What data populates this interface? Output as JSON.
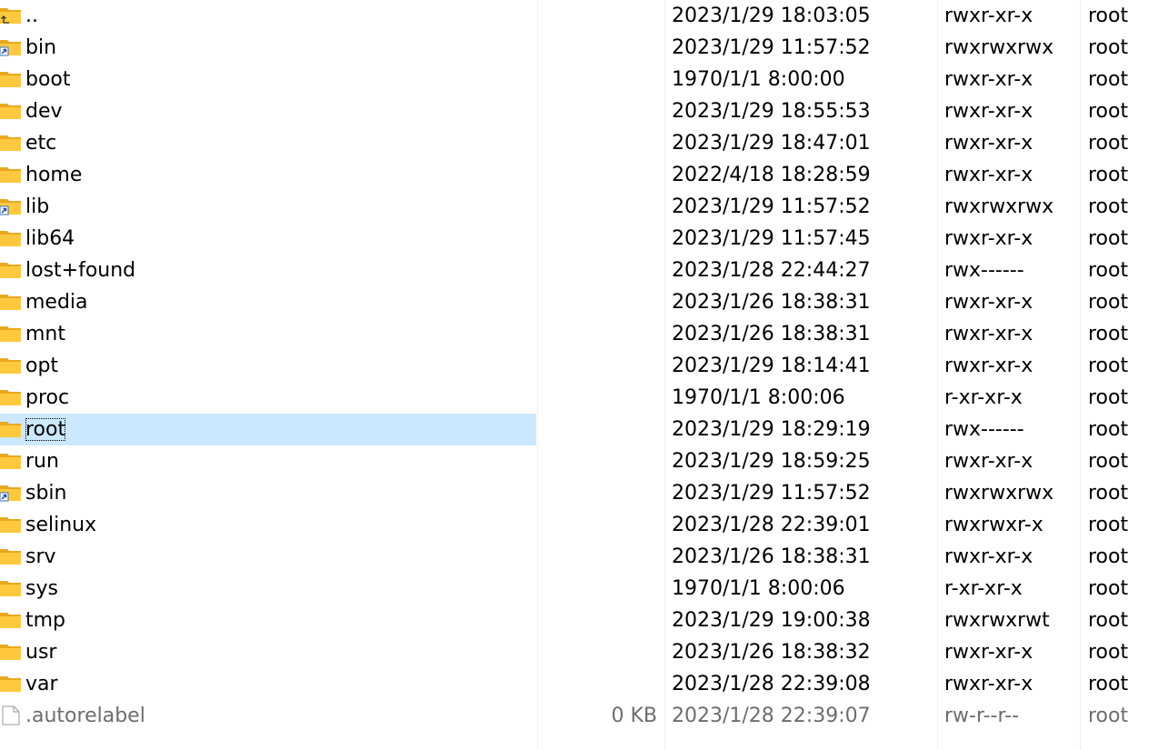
{
  "colors": {
    "selection": "#cce8ff",
    "folder": "#ffc93f",
    "file_text": "#6d6d6d"
  },
  "rows": [
    {
      "name": "..",
      "size": "",
      "date": "2023/1/29 18:03:05",
      "perm": "rwxr-xr-x",
      "owner": "root",
      "icon": "parent-folder-icon"
    },
    {
      "name": "bin",
      "size": "",
      "date": "2023/1/29 11:57:52",
      "perm": "rwxrwxrwx",
      "owner": "root",
      "icon": "folder-shortcut-icon"
    },
    {
      "name": "boot",
      "size": "",
      "date": "1970/1/1 8:00:00",
      "perm": "rwxr-xr-x",
      "owner": "root",
      "icon": "folder-icon"
    },
    {
      "name": "dev",
      "size": "",
      "date": "2023/1/29 18:55:53",
      "perm": "rwxr-xr-x",
      "owner": "root",
      "icon": "folder-icon"
    },
    {
      "name": "etc",
      "size": "",
      "date": "2023/1/29 18:47:01",
      "perm": "rwxr-xr-x",
      "owner": "root",
      "icon": "folder-icon"
    },
    {
      "name": "home",
      "size": "",
      "date": "2022/4/18 18:28:59",
      "perm": "rwxr-xr-x",
      "owner": "root",
      "icon": "folder-icon"
    },
    {
      "name": "lib",
      "size": "",
      "date": "2023/1/29 11:57:52",
      "perm": "rwxrwxrwx",
      "owner": "root",
      "icon": "folder-shortcut-icon"
    },
    {
      "name": "lib64",
      "size": "",
      "date": "2023/1/29 11:57:45",
      "perm": "rwxr-xr-x",
      "owner": "root",
      "icon": "folder-icon"
    },
    {
      "name": "lost+found",
      "size": "",
      "date": "2023/1/28 22:44:27",
      "perm": "rwx------",
      "owner": "root",
      "icon": "folder-icon"
    },
    {
      "name": "media",
      "size": "",
      "date": "2023/1/26 18:38:31",
      "perm": "rwxr-xr-x",
      "owner": "root",
      "icon": "folder-icon"
    },
    {
      "name": "mnt",
      "size": "",
      "date": "2023/1/26 18:38:31",
      "perm": "rwxr-xr-x",
      "owner": "root",
      "icon": "folder-icon"
    },
    {
      "name": "opt",
      "size": "",
      "date": "2023/1/29 18:14:41",
      "perm": "rwxr-xr-x",
      "owner": "root",
      "icon": "folder-icon"
    },
    {
      "name": "proc",
      "size": "",
      "date": "1970/1/1 8:00:06",
      "perm": "r-xr-xr-x",
      "owner": "root",
      "icon": "folder-icon"
    },
    {
      "name": "root",
      "size": "",
      "date": "2023/1/29 18:29:19",
      "perm": "rwx------",
      "owner": "root",
      "icon": "folder-icon",
      "selected": true
    },
    {
      "name": "run",
      "size": "",
      "date": "2023/1/29 18:59:25",
      "perm": "rwxr-xr-x",
      "owner": "root",
      "icon": "folder-icon"
    },
    {
      "name": "sbin",
      "size": "",
      "date": "2023/1/29 11:57:52",
      "perm": "rwxrwxrwx",
      "owner": "root",
      "icon": "folder-shortcut-icon"
    },
    {
      "name": "selinux",
      "size": "",
      "date": "2023/1/28 22:39:01",
      "perm": "rwxrwxr-x",
      "owner": "root",
      "icon": "folder-icon"
    },
    {
      "name": "srv",
      "size": "",
      "date": "2023/1/26 18:38:31",
      "perm": "rwxr-xr-x",
      "owner": "root",
      "icon": "folder-icon"
    },
    {
      "name": "sys",
      "size": "",
      "date": "1970/1/1 8:00:06",
      "perm": "r-xr-xr-x",
      "owner": "root",
      "icon": "folder-icon"
    },
    {
      "name": "tmp",
      "size": "",
      "date": "2023/1/29 19:00:38",
      "perm": "rwxrwxrwt",
      "owner": "root",
      "icon": "folder-icon"
    },
    {
      "name": "usr",
      "size": "",
      "date": "2023/1/26 18:38:32",
      "perm": "rwxr-xr-x",
      "owner": "root",
      "icon": "folder-icon"
    },
    {
      "name": "var",
      "size": "",
      "date": "2023/1/28 22:39:08",
      "perm": "rwxr-xr-x",
      "owner": "root",
      "icon": "folder-icon"
    },
    {
      "name": ".autorelabel",
      "size": "0 KB",
      "date": "2023/1/28 22:39:07",
      "perm": "rw-r--r--",
      "owner": "root",
      "icon": "file-icon",
      "file": true
    }
  ]
}
